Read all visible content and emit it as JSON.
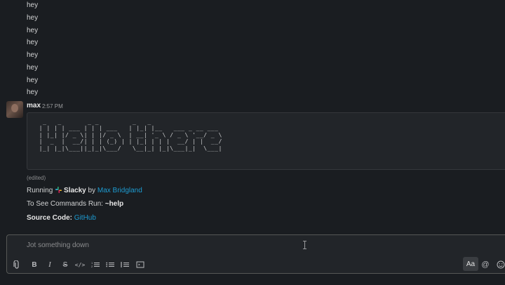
{
  "messages": {
    "repeated": [
      "hey",
      "hey",
      "hey",
      "hey",
      "hey",
      "hey",
      "hey",
      "hey"
    ],
    "author": "max",
    "time": "2:57 PM",
    "ascii_art": "   _   _       _ _         _   _               \n  | | | | ___ | | | ___   | |_| |__   ___ _ __ ___\n  | |_| |/ _ \\| | |/ _ \\  | __| '_ \\ / _ \\ '__/ _ \\\n  |  _  |  __/| | | (_) | | |_| | | |  __/ | |  __/\n  |_| |_|\\___||_|_|\\___/   \\__|_| |_|\\___|_|  \\___|",
    "edited": "(edited)",
    "running_prefix": "Running",
    "app_name": "Slacky",
    "by_text": "by",
    "author_link": "Max Bridgland",
    "commands_prefix": "To See Commands Run:",
    "commands_value": "~help",
    "source_prefix": "Source Code:",
    "source_link": "GitHub"
  },
  "composer": {
    "placeholder": "Jot something down",
    "format_button": "Aa",
    "mention_symbol": "@"
  },
  "icons": {
    "attach": "paperclip-icon",
    "bold": "bold-icon",
    "italic": "italic-icon",
    "strike": "strikethrough-icon",
    "code": "code-icon",
    "ordered": "ordered-list-icon",
    "bulleted": "bulleted-list-icon",
    "quote": "blockquote-icon",
    "codeblock": "code-block-icon",
    "emoji": "emoji-icon"
  },
  "colors": {
    "background": "#1a1d21",
    "link": "#1d9bd1",
    "text": "#d1d2d3"
  }
}
